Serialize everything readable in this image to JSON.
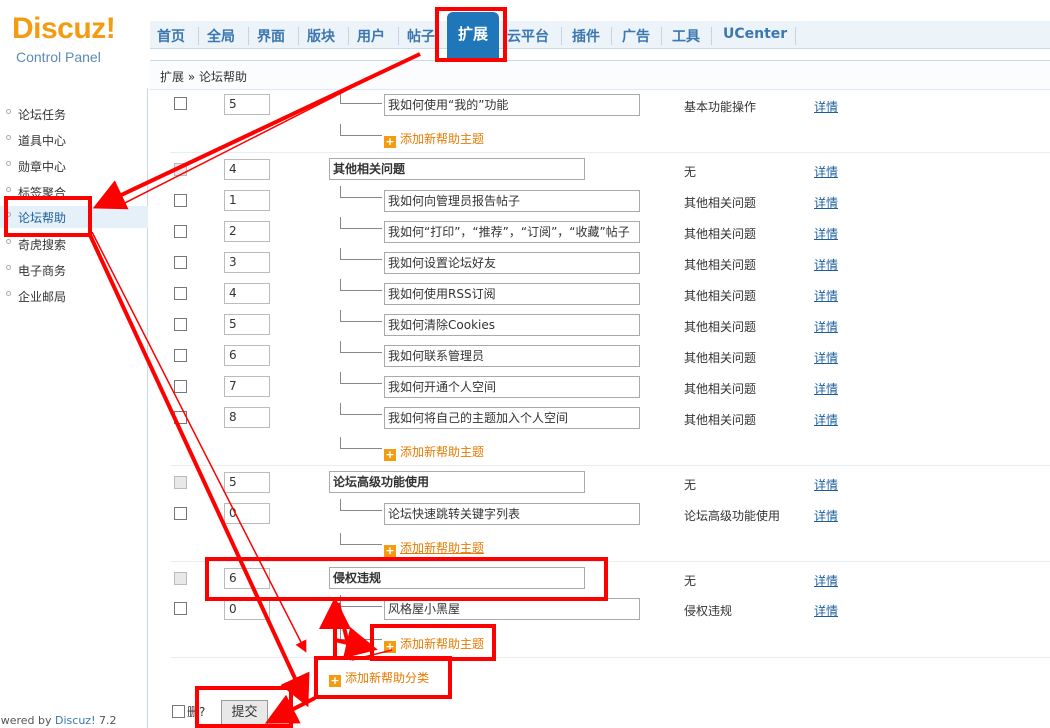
{
  "logo": {
    "brand": "Discuz!",
    "subtitle": "Control Panel"
  },
  "nav": {
    "items": [
      "首页",
      "全局",
      "界面",
      "版块",
      "用户",
      "帖子",
      "扩展",
      "云平台",
      "插件",
      "广告",
      "工具",
      "UCenter"
    ],
    "active": "扩展"
  },
  "breadcrumb": "扩展 » 论坛帮助",
  "sidebar": {
    "items": [
      "论坛任务",
      "道具中心",
      "勋章中心",
      "标签聚合",
      "论坛帮助",
      "奇虎搜索",
      "电子商务",
      "企业邮局"
    ],
    "active_index": 4
  },
  "powered": {
    "prefix": "owered by ",
    "brand": "Discuz!",
    "version": " 7.2"
  },
  "rows": {
    "r0": {
      "order": "5",
      "title": "我如何使用“我的”功能",
      "type": "基本功能操作",
      "detail": "详情"
    },
    "add0": "添加新帮助主题",
    "c1": {
      "order": "4",
      "name": "其他相关问题",
      "type": "无",
      "detail": "详情"
    },
    "r1": {
      "order": "1",
      "title": "我如何向管理员报告帖子",
      "type": "其他相关问题",
      "detail": "详情"
    },
    "r2": {
      "order": "2",
      "title": "我如何“打印”，“推荐”，“订阅”，“收藏”帖子",
      "type": "其他相关问题",
      "detail": "详情"
    },
    "r3": {
      "order": "3",
      "title": "我如何设置论坛好友",
      "type": "其他相关问题",
      "detail": "详情"
    },
    "r4": {
      "order": "4",
      "title": "我如何使用RSS订阅",
      "type": "其他相关问题",
      "detail": "详情"
    },
    "r5": {
      "order": "5",
      "title": "我如何清除Cookies",
      "type": "其他相关问题",
      "detail": "详情"
    },
    "r6": {
      "order": "6",
      "title": "我如何联系管理员",
      "type": "其他相关问题",
      "detail": "详情"
    },
    "r7": {
      "order": "7",
      "title": "我如何开通个人空间",
      "type": "其他相关问题",
      "detail": "详情"
    },
    "r8": {
      "order": "8",
      "title": "我如何将自己的主题加入个人空间",
      "type": "其他相关问题",
      "detail": "详情"
    },
    "add1": "添加新帮助主题",
    "c2": {
      "order": "5",
      "name": "论坛高级功能使用",
      "type": "无",
      "detail": "详情"
    },
    "r9": {
      "order": "0",
      "title": "论坛快速跳转关键字列表",
      "type": "论坛高级功能使用",
      "detail": "详情"
    },
    "add2": "添加新帮助主题",
    "c3": {
      "order": "6",
      "name": "侵权违规",
      "type": "无",
      "detail": "详情"
    },
    "r10": {
      "order": "0",
      "title": "风格屋小黑屋",
      "type": "侵权违规",
      "detail": "详情"
    },
    "add3": "添加新帮助主题",
    "addcat": "添加新帮助分类"
  },
  "footer": {
    "delete_label": "删?",
    "submit_label": "提交"
  },
  "colors": {
    "annotation": "#ff0000",
    "accent": "#1f76b8",
    "add_link": "#e87a00"
  }
}
